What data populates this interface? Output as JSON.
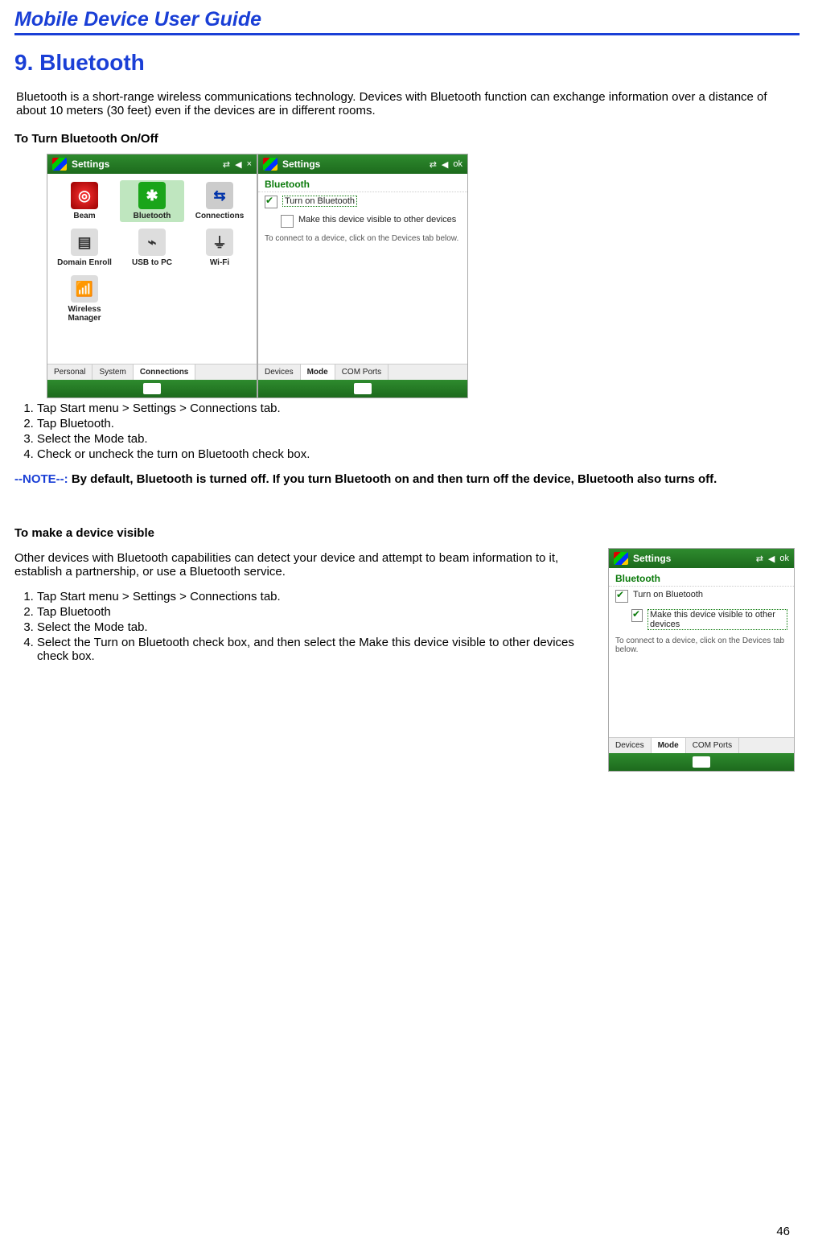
{
  "header": {
    "title": "Mobile Device User Guide"
  },
  "chapter": {
    "title": "9. Bluetooth"
  },
  "intro": "Bluetooth is a short-range wireless communications technology. Devices with Bluetooth function can exchange information over a distance of about 10 meters (30 feet) even if the devices are in different rooms.",
  "section1": {
    "heading": "To Turn Bluetooth On/Off"
  },
  "shot1": {
    "topbar_title": "Settings",
    "close_glyph": "×",
    "icons": {
      "beam": "Beam",
      "bluetooth": "Bluetooth",
      "connections": "Connections",
      "domain": "Domain Enroll",
      "usb": "USB to PC",
      "wifi": "Wi-Fi",
      "wireless": "Wireless Manager"
    },
    "tabs": {
      "a": "Personal",
      "b": "System",
      "c": "Connections"
    }
  },
  "shot2": {
    "topbar_title": "Settings",
    "ok": "ok",
    "pagetitle": "Bluetooth",
    "chk1": "Turn on Bluetooth",
    "chk2": "Make this device visible to other devices",
    "hint": "To connect to a device, click on the Devices tab below.",
    "tabs": {
      "a": "Devices",
      "b": "Mode",
      "c": "COM Ports"
    }
  },
  "steps1": {
    "s1": "Tap Start menu > Settings > Connections tab.",
    "s2": "Tap Bluetooth.",
    "s3": "Select the Mode tab.",
    "s4": "Check or uncheck the turn on Bluetooth check box."
  },
  "note": {
    "tag": "--NOTE--:",
    "text": " By default, Bluetooth is turned off. If you turn Bluetooth on and then turn off the device, Bluetooth also turns off."
  },
  "section2": {
    "heading": "To make a device visible",
    "intro": "Other devices with Bluetooth capabilities can detect your device and attempt to beam information to it, establish a partnership, or use a Bluetooth service."
  },
  "steps2": {
    "s1": "Tap Start menu > Settings > Connections tab.",
    "s2": "Tap Bluetooth",
    "s3": "Select the Mode tab.",
    "s4": "Select the Turn on Bluetooth check box, and then select the Make this device visible to other devices check box."
  },
  "shot3": {
    "topbar_title": "Settings",
    "ok": "ok",
    "pagetitle": "Bluetooth",
    "chk1": "Turn on Bluetooth",
    "chk2": "Make this device visible to other devices",
    "hint": "To connect to a device, click on the Devices tab below.",
    "tabs": {
      "a": "Devices",
      "b": "Mode",
      "c": "COM Ports"
    }
  },
  "page_number": "46"
}
